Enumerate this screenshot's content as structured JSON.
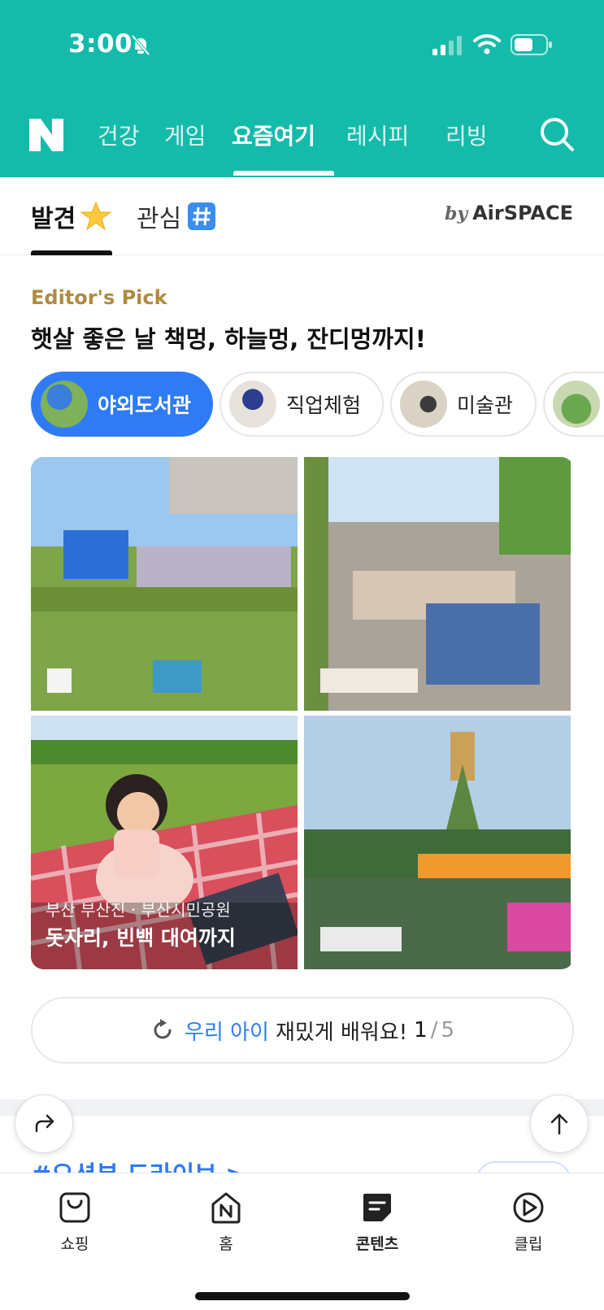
{
  "status_bar": {
    "time": "3:00"
  },
  "top_nav": {
    "tabs": [
      {
        "label": "건강"
      },
      {
        "label": "게임"
      },
      {
        "label": "요즘여기",
        "active": true
      },
      {
        "label": "레시피"
      },
      {
        "label": "리빙"
      }
    ]
  },
  "sub_tabs": {
    "discover": "발견",
    "interest": "관심",
    "by": "by",
    "brand": "AirSPACE"
  },
  "section": {
    "eyebrow": "Editor's Pick",
    "headline": "햇살 좋은 날 책멍, 하늘멍, 잔디멍까지!"
  },
  "chips": [
    {
      "label": "야외도서관",
      "active": true
    },
    {
      "label": "직업체험"
    },
    {
      "label": "미술관"
    }
  ],
  "cards": [
    {
      "location": "부산 부산진 · 부산시민공원",
      "title": "돗자리, 빈백 대여까지"
    }
  ],
  "pager": {
    "highlight": "우리 아이",
    "text": "재밌게 배워요!",
    "current": "1",
    "separator": "/",
    "total": "5"
  },
  "next_section_peek": "#오션뷰 드라이브 >",
  "bottom_nav": [
    {
      "label": "쇼핑",
      "icon": "shopping-bag-icon"
    },
    {
      "label": "홈",
      "icon": "home-icon"
    },
    {
      "label": "콘텐츠",
      "icon": "contents-icon",
      "active": true
    },
    {
      "label": "클립",
      "icon": "clip-icon"
    }
  ],
  "colors": {
    "header_bg": "#14BBAA",
    "accent_blue": "#2E7BF5",
    "eyebrow_gold": "#B08A3E"
  }
}
